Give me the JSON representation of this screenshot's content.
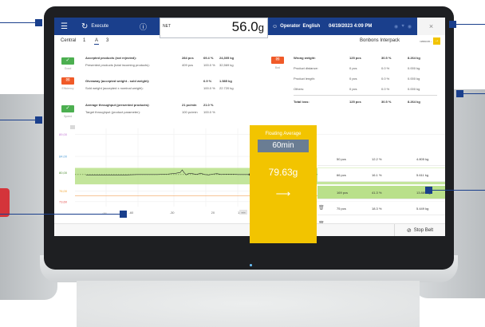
{
  "topbar": {
    "execute_label": "Execute",
    "net_label": "NET",
    "net_value": "56.0",
    "net_unit": "g",
    "operator_label": "Operator",
    "language_label": "English",
    "datetime": "04/19/2023 4:09 PM",
    "close_symbol": "×"
  },
  "subbar": {
    "central_label": "Central",
    "tabs": [
      "1",
      "A",
      "3"
    ],
    "product_name": "Bonbons Interpack",
    "product_code": "InBB0005 ›"
  },
  "tags": [
    {
      "symbol": "✓",
      "label": "Good",
      "color": "#4caf50"
    },
    {
      "symbol": "✉",
      "label": "Efficiency",
      "color": "#f05a28"
    },
    {
      "symbol": "✓",
      "label": "Speed",
      "color": "#4caf50"
    }
  ],
  "bad_tag": {
    "symbol": "✉",
    "label": "Bad",
    "color": "#f05a28"
  },
  "accepted": {
    "title": "Accepted products (not rejected):",
    "title_vals": [
      "284 pcs",
      "69.4 %",
      "24,305 kg"
    ],
    "sub": "Presented products (total incoming products):",
    "sub_vals": [
      "409 pcs",
      "100.0 %",
      "32,569 kg"
    ]
  },
  "giveaway": {
    "title": "Giveaway (accepted weight - sold weight):",
    "title_vals": [
      "6.9 %",
      "1.585 kg"
    ],
    "sub": "Sold weight (accepted x nominal weight):",
    "sub_vals": [
      "100.0 %",
      "22.720 kg"
    ]
  },
  "throughput": {
    "title": "Average throughput (presented products):",
    "title_vals": [
      "21 pc/min",
      "21.0 %"
    ],
    "sub": "Target throughput (product parameter):",
    "sub_vals": [
      "100 pc/min",
      "100.0 %"
    ]
  },
  "losses": [
    {
      "label": "Wrong weight:",
      "vals": [
        "125 pcs",
        "30.5 %",
        "8.264 kg"
      ]
    },
    {
      "label": "Product distance:",
      "vals": [
        "0 pcs",
        "0.0 %",
        "0.000 kg"
      ]
    },
    {
      "label": "Product length:",
      "vals": [
        "0 pcs",
        "0.0 %",
        "0.000 kg"
      ]
    },
    {
      "label": "Others:",
      "vals": [
        "0 pcs",
        "0.0 %",
        "0.000 kg"
      ]
    }
  ],
  "total_loss": {
    "label": "Total loss:",
    "vals": [
      "125 pcs",
      "30.5 %",
      "8.264 kg"
    ]
  },
  "floating": {
    "title": "Floating Average",
    "window": "60min",
    "value": "79.63g",
    "arrow": "⟶"
  },
  "chart_data": {
    "type": "line",
    "y_tick_labels": [
      "89,00",
      "84,00",
      "80,00",
      "76,00",
      "73,60"
    ],
    "x_tick_labels": [
      "-60",
      "-30",
      "20",
      "10"
    ],
    "x_small_labels": [
      "-min",
      "min"
    ],
    "band": {
      "from": 77.4,
      "to": 81.4,
      "color": "#b9e08a"
    },
    "reference_line": 79.8,
    "lower_limit_line": 74.6,
    "series": [
      {
        "x": [
          -80,
          -75,
          -70,
          -65,
          -60,
          -55,
          -50,
          -45,
          -40,
          -36,
          -34,
          -33,
          -32,
          -31,
          -30,
          -28,
          -26,
          -24,
          -22,
          -20,
          -18,
          -16,
          -14,
          -12,
          -10,
          -8,
          -6,
          -4,
          -2,
          0
        ],
        "values": [
          79.7,
          79.7,
          79.7,
          79.7,
          79.7,
          79.8,
          79.8,
          79.8,
          79.9,
          80.1,
          80.3,
          80.9,
          80.2,
          79.7,
          80.0,
          80.0,
          79.8,
          80.1,
          79.8,
          79.7,
          79.9,
          80.0,
          79.8,
          79.9,
          79.9,
          79.9,
          79.8,
          79.8,
          79.8,
          79.8
        ]
      }
    ]
  },
  "distribution": [
    {
      "pcs": "50 pcs",
      "pct": "12.2 %",
      "kg": "4.805 kg",
      "icon": ""
    },
    {
      "pcs": "66 pcs",
      "pct": "16.1 %",
      "kg": "5.611 kg",
      "icon": ""
    },
    {
      "pcs": "169 pcs",
      "pct": "41.3 %",
      "kg": "13.889 kg",
      "icon": ""
    },
    {
      "pcs": "75 pcs",
      "pct": "18.3 %",
      "kg": "5.449 kg",
      "icon": "trash-icon"
    },
    {
      "pcs": "50 pcs",
      "pct": "12.2 %",
      "kg": "2.615 kg",
      "icon": "trash-icon"
    }
  ],
  "bottombar": {
    "stop_label": "Stop Belt"
  },
  "colors": {
    "brand_blue": "#1a3f8c",
    "accent_yellow": "#f2c400",
    "band_green": "#b9e08a"
  }
}
